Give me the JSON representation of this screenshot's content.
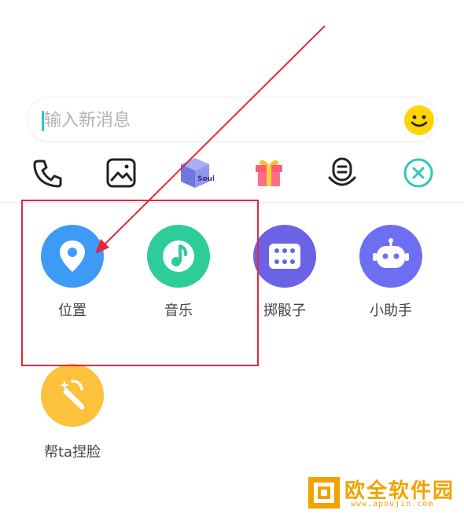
{
  "input": {
    "placeholder": "输入新消息"
  },
  "toolbar": {
    "items": [
      {
        "icon": "phone-icon"
      },
      {
        "icon": "image-icon"
      },
      {
        "icon": "soul-box-icon",
        "text": "Soul"
      },
      {
        "icon": "gift-icon"
      },
      {
        "icon": "voice-icon"
      },
      {
        "icon": "close-icon"
      }
    ]
  },
  "features": [
    {
      "label": "位置",
      "icon": "location-pin-icon",
      "color": "#3d9bf5"
    },
    {
      "label": "音乐",
      "icon": "music-note-icon",
      "color": "#2dcc99"
    },
    {
      "label": "掷骰子",
      "icon": "dice-icon",
      "color": "#6a63e6"
    },
    {
      "label": "小助手",
      "icon": "robot-icon",
      "color": "#6d6ef2"
    },
    {
      "label": "帮ta捏脸",
      "icon": "magic-wand-icon",
      "color": "#fcc23c"
    }
  ],
  "colors": {
    "accent": "#2fc7c0",
    "annotation": "#e8263a",
    "watermark": "#f2a200"
  },
  "watermark": {
    "text": "欧全软件园",
    "url": "www.apoujin.com"
  }
}
